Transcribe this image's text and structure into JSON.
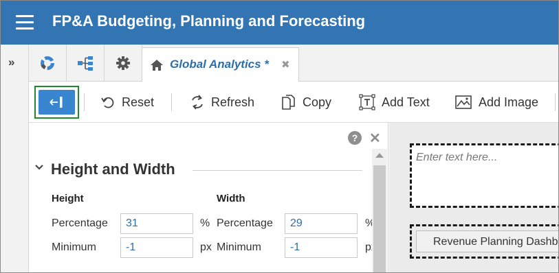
{
  "header": {
    "title": "FP&A Budgeting, Planning and Forecasting"
  },
  "tabs": {
    "active_label": "Global Analytics *"
  },
  "toolbar": {
    "reset_label": "Reset",
    "refresh_label": "Refresh",
    "copy_label": "Copy",
    "add_text_label": "Add Text",
    "add_image_label": "Add Image"
  },
  "panel": {
    "section_title": "Height and Width",
    "height": {
      "heading": "Height",
      "percentage_label": "Percentage",
      "percentage_value": "31",
      "percentage_unit": "%",
      "minimum_label": "Minimum",
      "minimum_value": "-1",
      "minimum_unit": "px"
    },
    "width": {
      "heading": "Width",
      "percentage_label": "Percentage",
      "percentage_value": "29",
      "percentage_unit": "%",
      "minimum_label": "Minimum",
      "minimum_value": "-1",
      "minimum_unit": "px"
    }
  },
  "canvas": {
    "textbox_placeholder": "Enter text here...",
    "dashboard_button_label": "Revenue Planning Dashboard"
  },
  "icons": {
    "menu": "hamburger-menu-icon",
    "rail": "double-chevron-right-icon",
    "tab1": "donut-chart-icon",
    "tab2": "hierarchy-icon",
    "tab3": "gear-icon",
    "active_tab": "home-icon",
    "collapse": "arrow-left-bar-icon"
  },
  "colors": {
    "header": "#3374b2",
    "accent": "#3a85cf",
    "focus_outline": "#1e8a2e",
    "tab_text": "#2e6ea8"
  }
}
